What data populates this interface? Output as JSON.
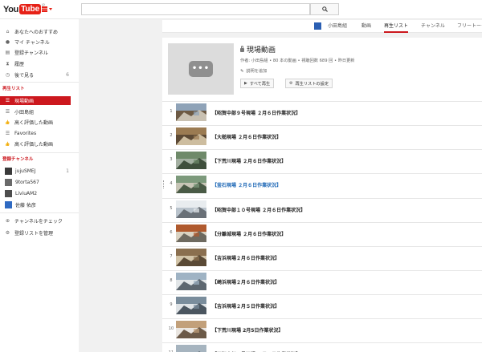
{
  "header": {
    "logo_you": "You",
    "logo_tube": "Tube",
    "logo_region": "JP",
    "search_value": ""
  },
  "sidebar": {
    "nav": [
      {
        "label": "あなたへのおすすめ",
        "icon": "home-icon"
      },
      {
        "label": "マイ チャンネル",
        "icon": "person-icon"
      },
      {
        "label": "登録チャンネル",
        "icon": "subscriptions-icon"
      },
      {
        "label": "履歴",
        "icon": "history-icon"
      },
      {
        "label": "後で見る",
        "icon": "watch-later-icon",
        "count": "6"
      }
    ],
    "playlists_heading": "再生リスト",
    "playlists": [
      {
        "label": "現場動画",
        "icon": "playlist-icon",
        "active": true
      },
      {
        "label": "小田島組",
        "icon": "playlist-icon"
      },
      {
        "label": "高く評価した動画",
        "icon": "thumbs-up-icon"
      },
      {
        "label": "Favorites",
        "icon": "playlist-icon"
      },
      {
        "label": "高く評価した動画",
        "icon": "thumbs-up-icon"
      }
    ],
    "subs_heading": "登録チャンネル",
    "subs": [
      {
        "label": "jujuSMEJ",
        "count": "1",
        "color": "#3a3a3a"
      },
      {
        "label": "9torta567",
        "color": "#6a6a6a"
      },
      {
        "label": "LiviuAM2",
        "color": "#4d4d4d"
      },
      {
        "label": "佐藤 佑彦",
        "color": "#2f6ac2"
      }
    ],
    "footer": [
      {
        "label": "チャンネルをチェック",
        "icon": "plus-circle-icon"
      },
      {
        "label": "登録リストを管理",
        "icon": "gear-icon"
      }
    ]
  },
  "channel_nav": {
    "name": "小田島組",
    "tabs": [
      "動画",
      "再生リスト",
      "チャンネル",
      "フリートーク"
    ],
    "active": "再生リスト"
  },
  "playlist": {
    "title": "現場動画",
    "meta": "作者: 小田島組 • 80 本の動画 • 視聴回数 689 回 • 昨日更新",
    "desc_link": "説明を追加",
    "play_all": "すべて再生",
    "settings": "再生リストの設定"
  },
  "videos": [
    {
      "num": "1",
      "title": "【昭賀中部９号現場 ２月６日作業状況】"
    },
    {
      "num": "2",
      "title": "【大槌現場 ２月６日作業状況】"
    },
    {
      "num": "3",
      "title": "【下荒川現場 ２月６日作業状況】"
    },
    {
      "num": "4",
      "title": "【釜石現場 ２月６日作業状況】",
      "link": true
    },
    {
      "num": "5",
      "title": "【昭賀中部１０号現場 ２月６日作業状況】"
    },
    {
      "num": "6",
      "title": "【分離城現場 ２月６日作業状況】"
    },
    {
      "num": "7",
      "title": "【吉浜現場２月６日作業状況】"
    },
    {
      "num": "8",
      "title": "【崎浜現場２月６日作業状況】"
    },
    {
      "num": "9",
      "title": "【吉浜現場２月５日作業状況】"
    },
    {
      "num": "10",
      "title": "【下荒川現場 2月5日作業状況】"
    },
    {
      "num": "11",
      "title": "【昭賀中部９号現場 ２月５日作業状況】"
    }
  ],
  "colors": {
    "brand": "#e62117",
    "active_sidebar": "#cc181e",
    "link": "#1b66b5"
  }
}
